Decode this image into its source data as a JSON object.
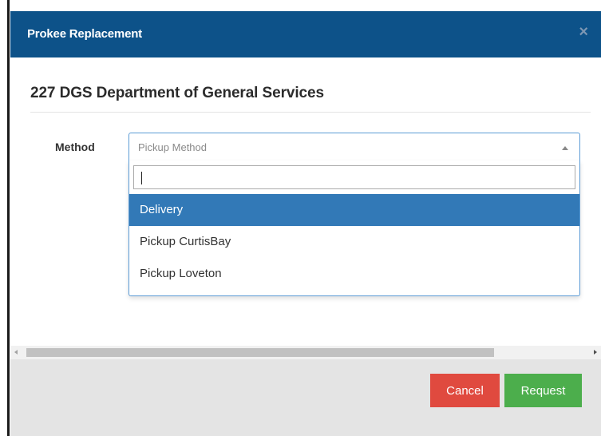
{
  "modal": {
    "title": "Prokee Replacement",
    "close_glyph": "×",
    "department": "227 DGS Department of General Services"
  },
  "form": {
    "method_label": "Method",
    "method_select": {
      "placeholder": "Pickup Method",
      "search_value": "",
      "options": [
        {
          "label": "Delivery",
          "highlighted": true
        },
        {
          "label": "Pickup CurtisBay",
          "highlighted": false
        },
        {
          "label": "Pickup Loveton",
          "highlighted": false
        }
      ]
    }
  },
  "footer": {
    "cancel_label": "Cancel",
    "request_label": "Request"
  },
  "colors": {
    "header": "#0d5289",
    "highlight": "#3279b7",
    "cancel": "#e04a3f",
    "request": "#4cae4c"
  },
  "icons": [
    "close-icon",
    "caret-up-icon",
    "scroll-left-arrow-icon",
    "scroll-right-arrow-icon"
  ]
}
